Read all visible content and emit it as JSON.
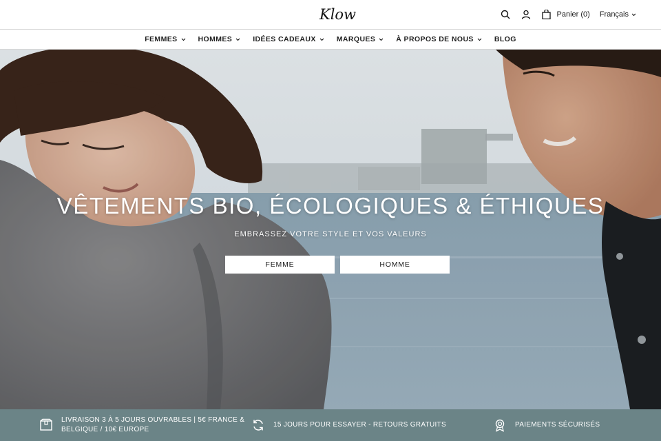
{
  "header": {
    "logo_text": "Klow",
    "cart_label": "Panier (0)",
    "language": "Français",
    "icons": [
      "search-icon",
      "user-icon",
      "shopping-bag-icon"
    ]
  },
  "nav": {
    "items": [
      {
        "label": "FEMMES",
        "has_dropdown": true
      },
      {
        "label": "HOMMES",
        "has_dropdown": true
      },
      {
        "label": "IDÉES CADEAUX",
        "has_dropdown": true
      },
      {
        "label": "MARQUES",
        "has_dropdown": true
      },
      {
        "label": "À PROPOS DE NOUS",
        "has_dropdown": true
      },
      {
        "label": "BLOG",
        "has_dropdown": false
      }
    ]
  },
  "hero": {
    "title": "VÊTEMENTS BIO, ÉCOLOGIQUES & ÉTHIQUES",
    "subtitle": "EMBRASSEZ VOTRE STYLE ET VOS VALEURS",
    "buttons": [
      "FEMME",
      "HOMME"
    ]
  },
  "infobar": {
    "bg_color": "#6b8487",
    "items": [
      {
        "icon": "package-icon",
        "text_line1": "LIVRAISON 3 À 5 JOURS OUVRABLES | 5€ FRANCE &",
        "text_line2": "BELGIQUE / 10€ EUROPE"
      },
      {
        "icon": "refresh-icon",
        "text": "15 JOURS POUR ESSAYER - RETOURS GRATUITS"
      },
      {
        "icon": "badge-icon",
        "text": "PAIEMENTS SÉCURISÉS"
      }
    ]
  }
}
